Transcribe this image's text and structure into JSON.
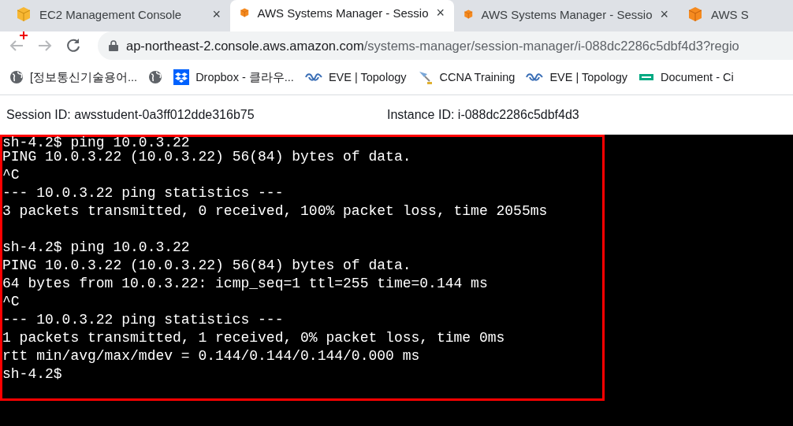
{
  "tabs": [
    {
      "title": "EC2 Management Console",
      "kind": "ec2",
      "selected": false,
      "close": "×"
    },
    {
      "title": "AWS Systems Manager - Sessio",
      "kind": "ssm",
      "selected": true,
      "close": "×"
    },
    {
      "title": "AWS Systems Manager - Sessio",
      "kind": "ssm",
      "selected": false,
      "close": "×"
    },
    {
      "title": "AWS S",
      "kind": "ssm",
      "selected": false
    }
  ],
  "address": {
    "host": "ap-northeast-2.console.aws.amazon.com",
    "path": "/systems-manager/session-manager/i-088dc2286c5dbf4d3?regio"
  },
  "bookmarks": [
    {
      "kind": "globe",
      "label": "[정보통신기술용어..."
    },
    {
      "kind": "globe"
    },
    {
      "kind": "dropbox",
      "label": "Dropbox - 클라우..."
    },
    {
      "kind": "eve",
      "label": "EVE | Topology"
    },
    {
      "kind": "ccna",
      "label": "CCNA Training"
    },
    {
      "kind": "eve",
      "label": "EVE | Topology"
    },
    {
      "kind": "doc",
      "label": "Document - Ci"
    }
  ],
  "session": {
    "session_id": "Session ID: awsstudent-0a3ff012dde316b75",
    "instance_id": "Instance ID: i-088dc2286c5dbf4d3"
  },
  "terminal": {
    "blocks": [
      [
        "sh-4.2$ ping 10.0.3.22",
        "PING 10.0.3.22 (10.0.3.22) 56(84) bytes of data.",
        "^C",
        "--- 10.0.3.22 ping statistics ---",
        "3 packets transmitted, 0 received, 100% packet loss, time 2055ms"
      ],
      [
        "sh-4.2$ ping 10.0.3.22",
        "PING 10.0.3.22 (10.0.3.22) 56(84) bytes of data.",
        "64 bytes from 10.0.3.22: icmp_seq=1 ttl=255 time=0.144 ms",
        "^C",
        "--- 10.0.3.22 ping statistics ---",
        "1 packets transmitted, 1 received, 0% packet loss, time 0ms",
        "rtt min/avg/max/mdev = 0.144/0.144/0.144/0.000 ms",
        "sh-4.2$"
      ]
    ]
  }
}
